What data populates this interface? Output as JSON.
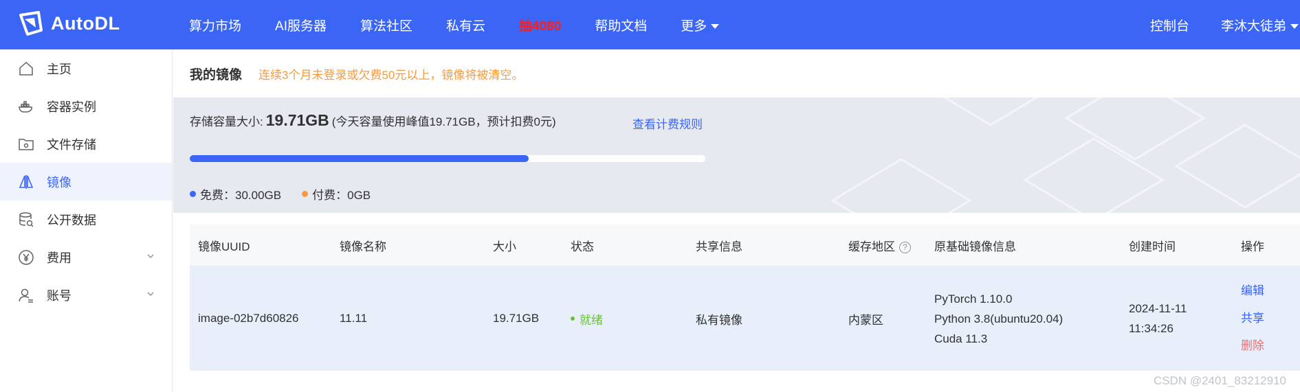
{
  "app": {
    "name": "AutoDL",
    "colors": {
      "primary": "#3b66f5",
      "hot": "#ff1c1c",
      "warning": "#f79a3e",
      "success": "#67c23a",
      "danger": "#f56c6c"
    }
  },
  "topnav": {
    "items": [
      "算力市场",
      "AI服务器",
      "算法社区",
      "私有云",
      "抽4080",
      "帮助文档",
      "更多"
    ],
    "console": "控制台",
    "user": "李沐大徒弟"
  },
  "sidebar": {
    "items": [
      {
        "label": "主页",
        "icon": "home-icon"
      },
      {
        "label": "容器实例",
        "icon": "container-icon"
      },
      {
        "label": "文件存储",
        "icon": "folder-icon"
      },
      {
        "label": "镜像",
        "icon": "image-icon"
      },
      {
        "label": "公开数据",
        "icon": "database-icon"
      },
      {
        "label": "费用",
        "icon": "yen-icon"
      },
      {
        "label": "账号",
        "icon": "user-icon"
      }
    ],
    "active_index": 3
  },
  "page": {
    "title": "我的镜像",
    "warning": "连续3个月未登录或欠费50元以上，镜像将被清空。"
  },
  "storage": {
    "label": "存储容量大小:",
    "value": "19.71GB",
    "note": "(今天容量使用峰值19.71GB，预计扣费0元)",
    "link": "查看计费规则",
    "used_fraction": 0.657,
    "legend": [
      {
        "label": "免费：30.00GB",
        "color": "#3b66f5"
      },
      {
        "label": "付费：0GB",
        "color": "#f79a3e"
      }
    ]
  },
  "table": {
    "columns": [
      "镜像UUID",
      "镜像名称",
      "大小",
      "状态",
      "共享信息",
      "缓存地区",
      "原基础镜像信息",
      "创建时间",
      "操作"
    ],
    "rows": [
      {
        "uuid": "image-02b7d60826",
        "name": "11.11",
        "size": "19.71GB",
        "status": "就绪",
        "share": "私有镜像",
        "region": "内蒙区",
        "base": [
          "PyTorch  1.10.0",
          "Python  3.8(ubuntu20.04)",
          "Cuda  11.3"
        ],
        "created": "2024-11-11 11:34:26",
        "ops": [
          "编辑",
          "共享",
          "删除"
        ]
      }
    ]
  },
  "watermark": "CSDN @2401_83212910"
}
